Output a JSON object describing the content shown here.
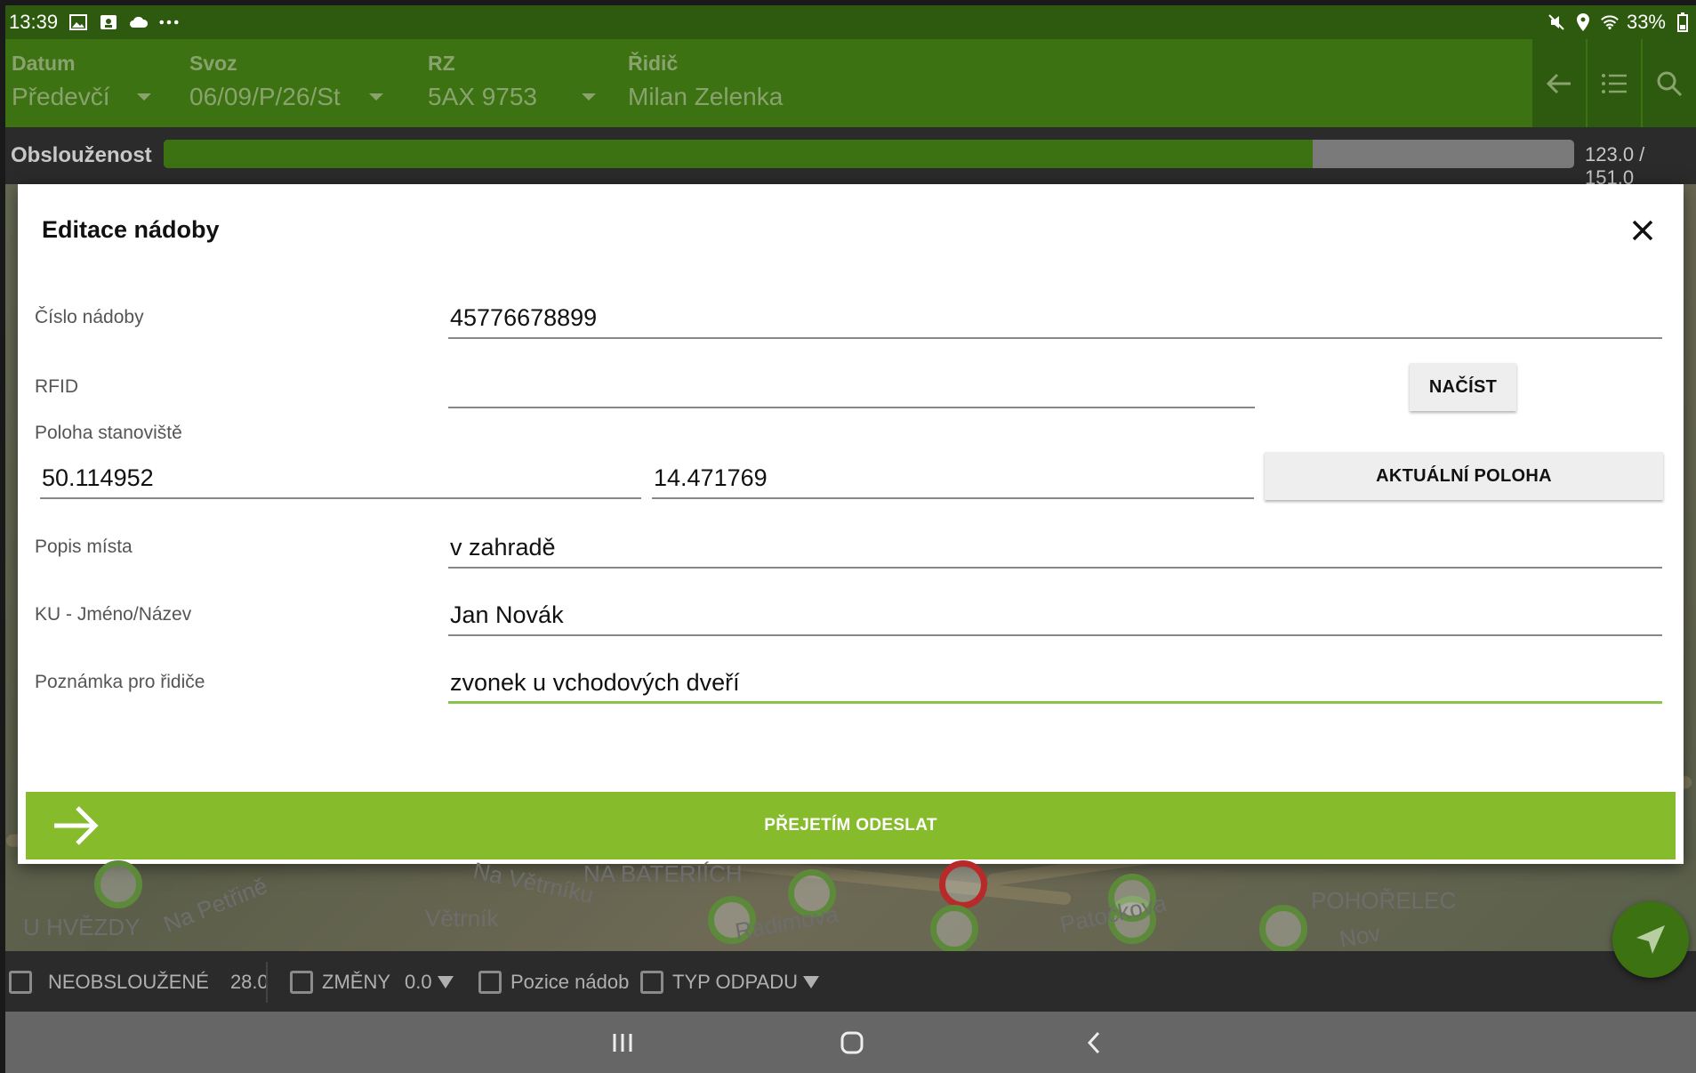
{
  "status_bar": {
    "time": "13:39",
    "left_icons": [
      "gallery-icon",
      "calendar-user-icon",
      "cloud-icon",
      "more-dots-icon"
    ],
    "right_icons": [
      "mute-icon",
      "location-icon",
      "wifi-icon"
    ],
    "battery": "33%"
  },
  "app_bar": {
    "datum": {
      "label": "Datum",
      "value": "Předevčí"
    },
    "svoz": {
      "label": "Svoz",
      "value": "06/09/P/26/St"
    },
    "rz": {
      "label": "RZ",
      "value": "5AX 9753"
    },
    "ridic": {
      "label": "Řidič",
      "value": "Milan Zelenka"
    },
    "actions": [
      "back-arrow-icon",
      "list-icon",
      "search-icon"
    ]
  },
  "progress": {
    "label": "Obslouženost",
    "done": 123.0,
    "total": 151.0,
    "text": "123.0 / 151.0"
  },
  "map": {
    "labels": [
      "U HVĚZDY",
      "Na Petřině",
      "Na Větrníku",
      "Větrník",
      "NA BATERIÍCH",
      "Radimova",
      "Patočkova",
      "POHOŘELEC",
      "Nov"
    ]
  },
  "dialog": {
    "title": "Editace nádoby",
    "cislo_nadoby": {
      "label": "Číslo nádoby",
      "value": "45776678899"
    },
    "rfid": {
      "label": "RFID",
      "value": "",
      "button": "NAČÍST"
    },
    "poloha": {
      "label": "Poloha stanoviště",
      "lat": "50.114952",
      "lon": "14.471769",
      "button": "AKTUÁLNÍ POLOHA"
    },
    "popis_mista": {
      "label": "Popis místa",
      "value": "v zahradě"
    },
    "ku": {
      "label": "KU - Jméno/Název",
      "value": "Jan Novák"
    },
    "poznamka": {
      "label": "Poznámka pro řidiče",
      "value": "zvonek u vchodových dveří"
    },
    "submit": "PŘEJETÍM ODESLAT"
  },
  "filter_bar": {
    "neobsluzene": {
      "label": "NEOBSLOUŽENÉ",
      "value": "28.0"
    },
    "zmeny": {
      "label": "ZMĚNY",
      "value": "0.0"
    },
    "pozice": {
      "label": "Pozice nádob"
    },
    "typ_odpadu": {
      "label": "TYP ODPADU"
    }
  },
  "colors": {
    "primary_dark": "#2d5a0e",
    "primary": "#3c7212",
    "accent": "#86bb2c",
    "focus_underline": "#8bc34a"
  }
}
